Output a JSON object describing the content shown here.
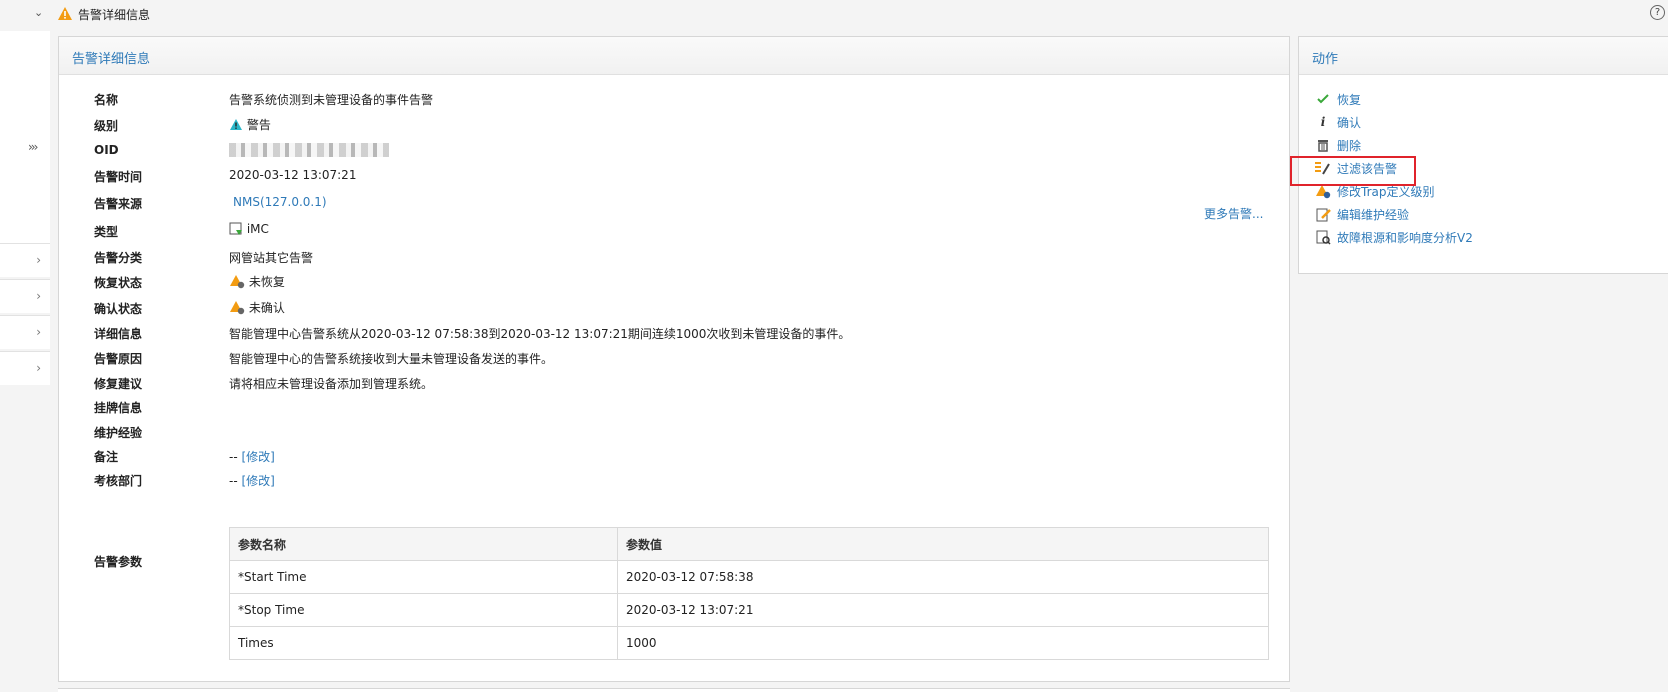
{
  "header": {
    "title": "告警详细信息"
  },
  "detail": {
    "panel_title": "告警详细信息",
    "labels": {
      "name": "名称",
      "level": "级别",
      "oid": "OID",
      "time": "告警时间",
      "source": "告警来源",
      "type": "类型",
      "category": "告警分类",
      "recovery": "恢复状态",
      "ack": "确认状态",
      "detail": "详细信息",
      "reason": "告警原因",
      "suggestion": "修复建议",
      "tag": "挂牌信息",
      "maintenance": "维护经验",
      "note": "备注",
      "dept": "考核部门",
      "params": "告警参数"
    },
    "values": {
      "name": "告警系统侦测到未管理设备的事件告警",
      "level": "警告",
      "time": "2020-03-12 13:07:21",
      "source": "NMS(127.0.0.1)",
      "more_alarms": "更多告警...",
      "type": "iMC",
      "category": "网管站其它告警",
      "recovery": "未恢复",
      "ack": "未确认",
      "detail": "智能管理中心告警系统从2020-03-12 07:58:38到2020-03-12 13:07:21期间连续1000次收到未管理设备的事件。",
      "reason": "智能管理中心的告警系统接收到大量未管理设备发送的事件。",
      "suggestion": "请将相应未管理设备添加到管理系统。",
      "note_prefix": "--",
      "note_edit": "[修改]",
      "dept_prefix": "--",
      "dept_edit": "[修改]"
    },
    "param_table": {
      "headers": [
        "参数名称",
        "参数值"
      ],
      "rows": [
        [
          "*Start Time",
          "2020-03-12 07:58:38"
        ],
        [
          "*Stop Time",
          "2020-03-12 13:07:21"
        ],
        [
          "Times",
          "1000"
        ]
      ]
    }
  },
  "actions": {
    "panel_title": "动作",
    "items": [
      {
        "label": "恢复",
        "icon": "check-icon"
      },
      {
        "label": "确认",
        "icon": "info-icon"
      },
      {
        "label": "删除",
        "icon": "trash-icon"
      },
      {
        "label": "过滤该告警",
        "icon": "filter-icon"
      },
      {
        "label": "修改Trap定义级别",
        "icon": "warning-edit-icon"
      },
      {
        "label": "编辑维护经验",
        "icon": "edit-icon"
      },
      {
        "label": "故障根源和影响度分析V2",
        "icon": "analysis-icon"
      }
    ]
  },
  "colors": {
    "link": "#2f7ab8",
    "highlight": "#e0232b",
    "warning": "#f39c12",
    "check": "#3aa83a"
  }
}
